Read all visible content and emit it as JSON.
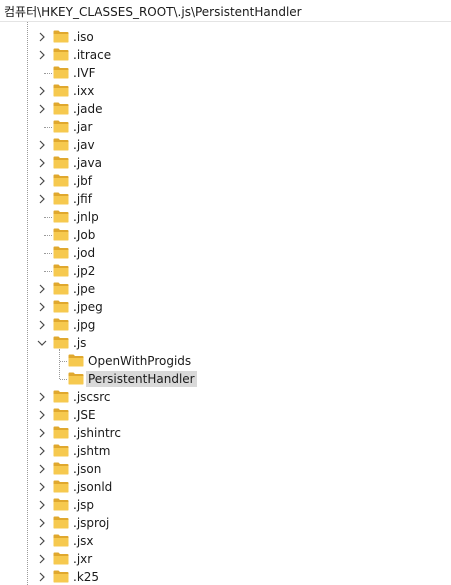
{
  "address_bar": {
    "path": "컴퓨터\\HKEY_CLASSES_ROOT\\.js\\PersistentHandler"
  },
  "tree": {
    "items": [
      {
        "label": ".iso",
        "expander": "collapsed",
        "level": 1
      },
      {
        "label": ".itrace",
        "expander": "collapsed",
        "level": 1
      },
      {
        "label": ".IVF",
        "expander": "none",
        "level": 1
      },
      {
        "label": ".ixx",
        "expander": "collapsed",
        "level": 1
      },
      {
        "label": ".jade",
        "expander": "collapsed",
        "level": 1
      },
      {
        "label": ".jar",
        "expander": "none",
        "level": 1
      },
      {
        "label": ".jav",
        "expander": "collapsed",
        "level": 1
      },
      {
        "label": ".java",
        "expander": "collapsed",
        "level": 1
      },
      {
        "label": ".jbf",
        "expander": "collapsed",
        "level": 1
      },
      {
        "label": ".jfif",
        "expander": "collapsed",
        "level": 1
      },
      {
        "label": ".jnlp",
        "expander": "none",
        "level": 1
      },
      {
        "label": ".Job",
        "expander": "none",
        "level": 1
      },
      {
        "label": ".jod",
        "expander": "none",
        "level": 1
      },
      {
        "label": ".jp2",
        "expander": "none",
        "level": 1
      },
      {
        "label": ".jpe",
        "expander": "collapsed",
        "level": 1
      },
      {
        "label": ".jpeg",
        "expander": "collapsed",
        "level": 1
      },
      {
        "label": ".jpg",
        "expander": "collapsed",
        "level": 1
      },
      {
        "label": ".js",
        "expander": "expanded",
        "level": 1
      },
      {
        "label": "OpenWithProgids",
        "expander": "none",
        "level": 2
      },
      {
        "label": "PersistentHandler",
        "expander": "none",
        "level": 2,
        "selected": true
      },
      {
        "label": ".jscsrc",
        "expander": "collapsed",
        "level": 1
      },
      {
        "label": ".JSE",
        "expander": "collapsed",
        "level": 1
      },
      {
        "label": ".jshintrc",
        "expander": "collapsed",
        "level": 1
      },
      {
        "label": ".jshtm",
        "expander": "collapsed",
        "level": 1
      },
      {
        "label": ".json",
        "expander": "collapsed",
        "level": 1
      },
      {
        "label": ".jsonld",
        "expander": "collapsed",
        "level": 1
      },
      {
        "label": ".jsp",
        "expander": "collapsed",
        "level": 1
      },
      {
        "label": ".jsproj",
        "expander": "collapsed",
        "level": 1
      },
      {
        "label": ".jsx",
        "expander": "collapsed",
        "level": 1
      },
      {
        "label": ".jxr",
        "expander": "collapsed",
        "level": 1
      },
      {
        "label": ".k25",
        "expander": "collapsed",
        "level": 1
      }
    ]
  },
  "colors": {
    "folder_fill": "#f6c94f",
    "folder_dark": "#e0a82e",
    "selection": "#d9d9d9",
    "guide": "#9a9a9a",
    "chevron": "#4a4a4a"
  },
  "icons": {
    "folder": "folder-icon",
    "collapsed": "chevron-right-icon",
    "expanded": "chevron-down-icon"
  }
}
